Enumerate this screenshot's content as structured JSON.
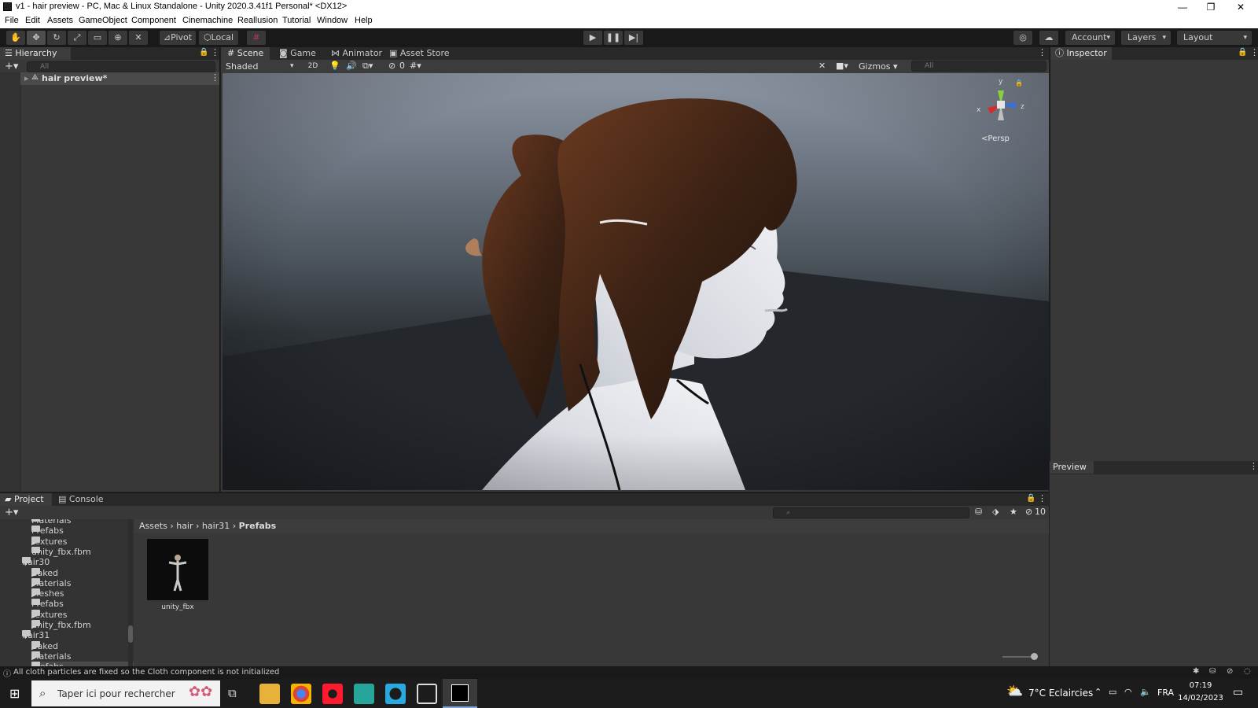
{
  "window": {
    "title": "v1 - hair preview - PC, Mac & Linux Standalone - Unity 2020.3.41f1 Personal* <DX12>",
    "minimize": "—",
    "maximize": "❐",
    "close": "✕"
  },
  "menu": [
    "File",
    "Edit",
    "Assets",
    "GameObject",
    "Component",
    "Cinemachine",
    "Reallusion",
    "Tutorial",
    "Window",
    "Help"
  ],
  "toolbar": {
    "pivot_label": "Pivot",
    "local_label": "Local",
    "account_label": "Account",
    "layers_label": "Layers",
    "layout_label": "Layout"
  },
  "hierarchy": {
    "tab_label": "Hierarchy",
    "search_placeholder": "All",
    "root_item": "hair preview*"
  },
  "scene": {
    "tabs": [
      "Scene",
      "Game",
      "Animator",
      "Asset Store"
    ],
    "shading_mode": "Shaded",
    "mode_2d": "2D",
    "hidden_count": "0",
    "gizmos_label": "Gizmos",
    "search_placeholder": "All",
    "gizmo_axes": {
      "y": "y",
      "x": "x",
      "z": "z"
    },
    "projection_label": "Persp"
  },
  "inspector": {
    "tab_label": "Inspector",
    "preview_label": "Preview"
  },
  "project": {
    "tabs": [
      "Project",
      "Console"
    ],
    "tree": [
      {
        "label": "Materials",
        "indent": 2,
        "arrow": "",
        "partial": true
      },
      {
        "label": "Prefabs",
        "indent": 2,
        "arrow": ""
      },
      {
        "label": "textures",
        "indent": 2,
        "arrow": "▶"
      },
      {
        "label": "unity_fbx.fbm",
        "indent": 2,
        "arrow": ""
      },
      {
        "label": "hair30",
        "indent": 1,
        "arrow": "▼"
      },
      {
        "label": "Baked",
        "indent": 2,
        "arrow": "▶"
      },
      {
        "label": "Materials",
        "indent": 2,
        "arrow": "▶"
      },
      {
        "label": "Meshes",
        "indent": 2,
        "arrow": "▶"
      },
      {
        "label": "Prefabs",
        "indent": 2,
        "arrow": ""
      },
      {
        "label": "textures",
        "indent": 2,
        "arrow": "▶"
      },
      {
        "label": "unity_fbx.fbm",
        "indent": 2,
        "arrow": "▶"
      },
      {
        "label": "hair31",
        "indent": 1,
        "arrow": "▼"
      },
      {
        "label": "Baked",
        "indent": 2,
        "arrow": "▶"
      },
      {
        "label": "Materials",
        "indent": 2,
        "arrow": "▶"
      },
      {
        "label": "Prefabs",
        "indent": 2,
        "arrow": "",
        "selected": true
      }
    ],
    "breadcrumb": [
      "Assets",
      "hair",
      "hair31",
      "Prefabs"
    ],
    "hidden_count": "10",
    "asset_name": "unity_fbx",
    "zoom_level": 0.9
  },
  "status": {
    "message": "All cloth particles are fixed so the Cloth component is not initialized"
  },
  "taskbar": {
    "search_placeholder": "Taper ici pour rechercher",
    "weather": "7°C  Eclaircies",
    "language": "FRA",
    "time": "07:19",
    "date": "14/02/2023"
  },
  "colors": {
    "editor_bg": "#383838",
    "toolbar_bg": "#191919",
    "selection": "#2c5d87",
    "hair": "#3a2114",
    "skin": "#e6e8ee"
  }
}
